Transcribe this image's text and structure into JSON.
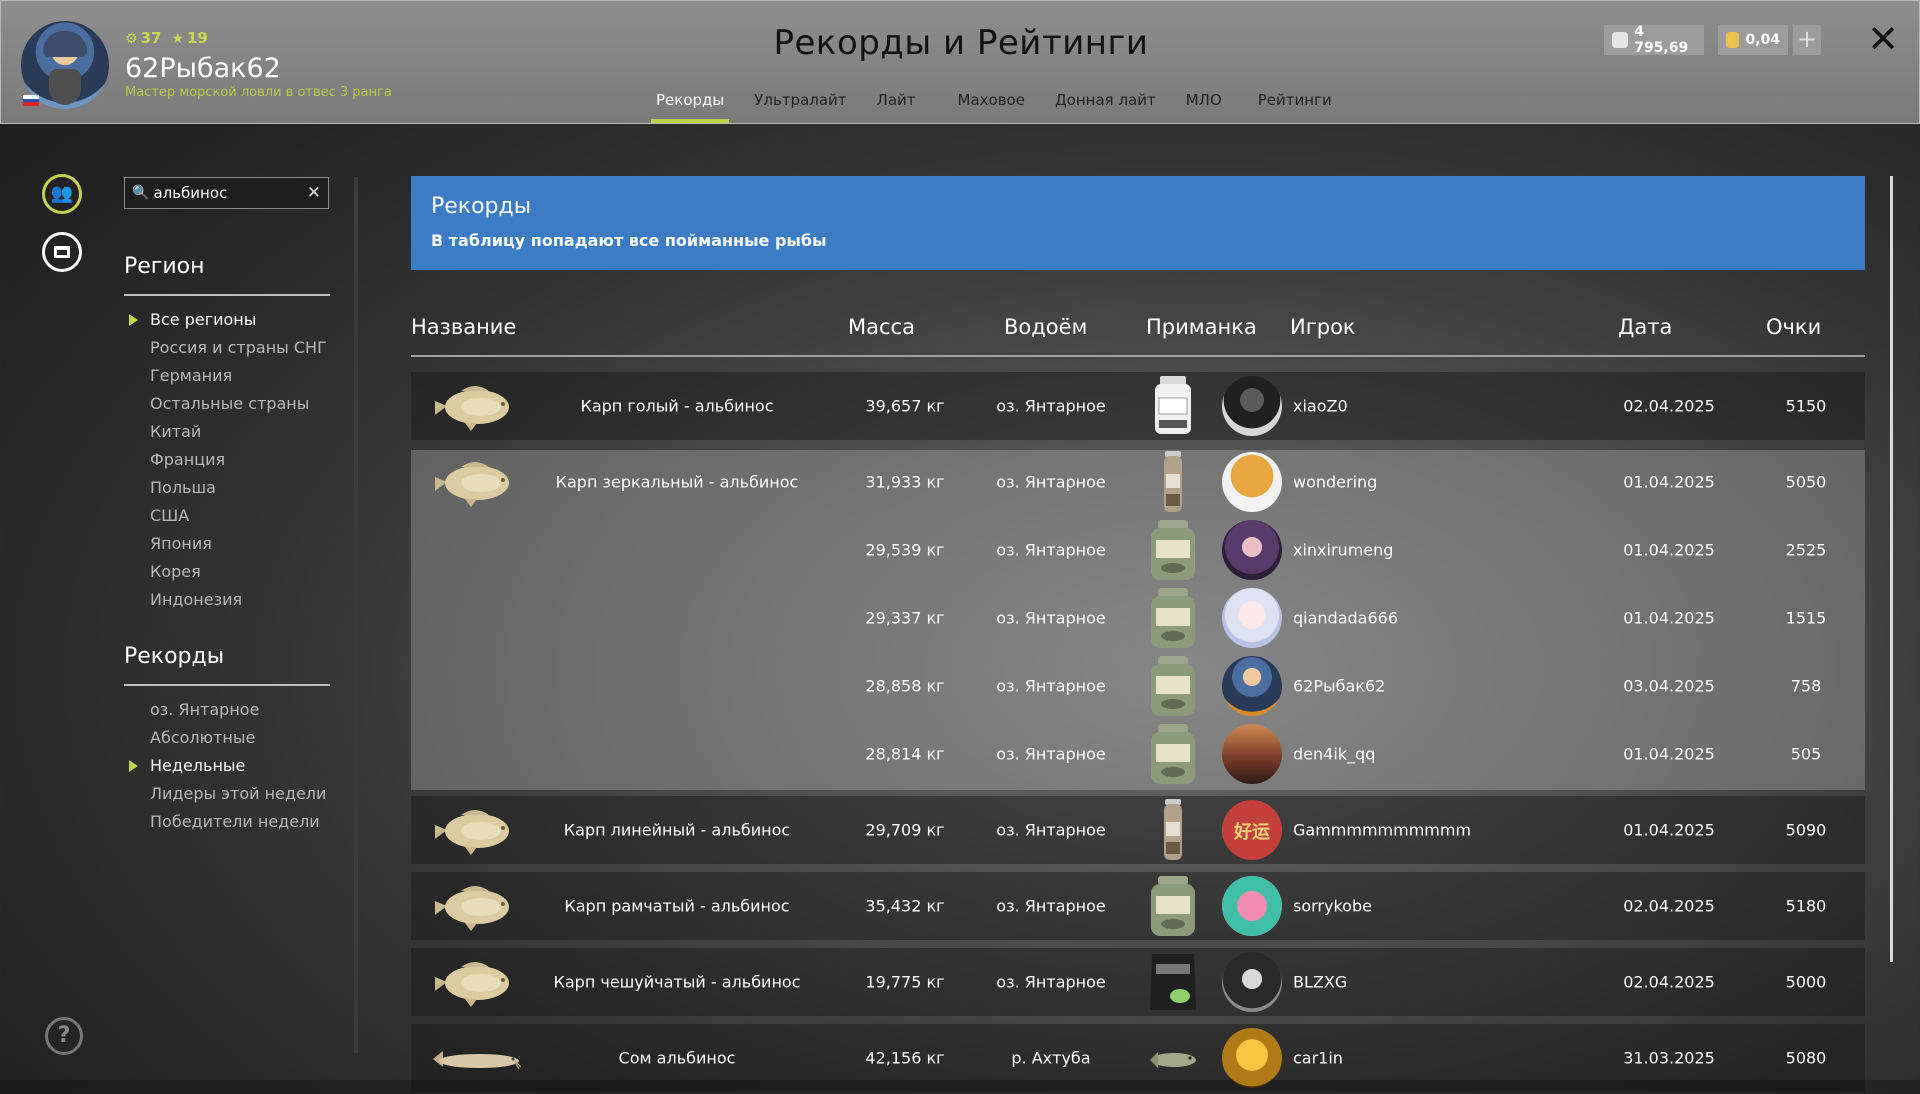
{
  "header": {
    "level": "37",
    "stars": "19",
    "username": "62Рыбак62",
    "rank": "Мастер морской ловли в отвес 3 ранга",
    "title": "Рекорды и Рейтинги",
    "tabs": [
      "Рекорды",
      "Ультралайт",
      "Лайт",
      "Маховое",
      "Донная лайт",
      "МЛО",
      "Рейтинги"
    ],
    "active_tab": "Рекорды",
    "silver": "4 795,69",
    "gold": "0,04"
  },
  "search": {
    "value": "альбинос"
  },
  "sidebar": {
    "region_title": "Регион",
    "regions": [
      {
        "label": "Все регионы",
        "active": true
      },
      {
        "label": "Россия и страны СНГ",
        "active": false
      },
      {
        "label": "Германия",
        "active": false
      },
      {
        "label": "Остальные страны",
        "active": false
      },
      {
        "label": "Китай",
        "active": false
      },
      {
        "label": "Франция",
        "active": false
      },
      {
        "label": "Польша",
        "active": false
      },
      {
        "label": "США",
        "active": false
      },
      {
        "label": "Япония",
        "active": false
      },
      {
        "label": "Корея",
        "active": false
      },
      {
        "label": "Индонезия",
        "active": false
      }
    ],
    "records_title": "Рекорды",
    "records": [
      {
        "label": "оз. Янтарное",
        "active": false
      },
      {
        "label": "Абсолютные",
        "active": false
      },
      {
        "label": "Недельные",
        "active": true
      },
      {
        "label": "Лидеры этой недели",
        "active": false
      },
      {
        "label": "Победители недели",
        "active": false
      }
    ]
  },
  "banner": {
    "title": "Рекорды",
    "subtitle": "В таблицу попадают все пойманные рыбы"
  },
  "table": {
    "columns": {
      "name": "Название",
      "mass": "Масса",
      "water": "Водоём",
      "bait": "Приманка",
      "player": "Игрок",
      "date": "Дата",
      "points": "Очки"
    },
    "rows": [
      {
        "name": "Карп голый - альбинос",
        "mass": "39,657 кг",
        "water": "оз. Янтарное",
        "player": "xiaoZ0",
        "date": "02.04.2025",
        "points": "5150",
        "fish": "carp",
        "bait": "jar-white",
        "avatar": "dark"
      },
      {
        "name": "Карп зеркальный - альбинос",
        "mass": "31,933 кг",
        "water": "оз. Янтарное",
        "player": "wondering",
        "date": "01.04.2025",
        "points": "5050",
        "fish": "carp",
        "bait": "tube",
        "avatar": "dog"
      },
      {
        "name": "",
        "mass": "29,539 кг",
        "water": "оз. Янтарное",
        "player": "xinxirumeng",
        "date": "01.04.2025",
        "points": "2525",
        "fish": "",
        "bait": "jar-green",
        "avatar": "girl"
      },
      {
        "name": "",
        "mass": "29,337 кг",
        "water": "оз. Янтарное",
        "player": "qiandada666",
        "date": "01.04.2025",
        "points": "1515",
        "fish": "",
        "bait": "jar-green",
        "avatar": "anime"
      },
      {
        "name": "",
        "mass": "28,858 кг",
        "water": "оз. Янтарное",
        "player": "62Рыбак62",
        "date": "03.04.2025",
        "points": "758",
        "fish": "",
        "bait": "jar-green",
        "avatar": "fisher"
      },
      {
        "name": "",
        "mass": "28,814 кг",
        "water": "оз. Янтарное",
        "player": "den4ik_qq",
        "date": "01.04.2025",
        "points": "505",
        "fish": "",
        "bait": "jar-green",
        "avatar": "sunset"
      },
      {
        "name": "Карп линейный - альбинос",
        "mass": "29,709 кг",
        "water": "оз. Янтарное",
        "player": "Gammmmmmmmmm",
        "date": "01.04.2025",
        "points": "5090",
        "fish": "carp",
        "bait": "tube",
        "avatar": "red-char",
        "avatar_text": "好运"
      },
      {
        "name": "Карп рамчатый - альбинос",
        "mass": "35,432 кг",
        "water": "оз. Янтарное",
        "player": "sorrykobe",
        "date": "02.04.2025",
        "points": "5180",
        "fish": "carp",
        "bait": "jar-green",
        "avatar": "pink"
      },
      {
        "name": "Карп чешуйчатый - альбинос",
        "mass": "19,775 кг",
        "water": "оз. Янтарное",
        "player": "BLZXG",
        "date": "02.04.2025",
        "points": "5000",
        "fish": "carp",
        "bait": "bag",
        "avatar": "mask"
      },
      {
        "name": "Сом альбинос",
        "mass": "42,156 кг",
        "water": "р. Ахтуба",
        "player": "car1in",
        "date": "31.03.2025",
        "points": "5080",
        "fish": "catfish",
        "bait": "fish",
        "avatar": "gold"
      }
    ]
  },
  "colors": {
    "accent_green": "#c3d34f",
    "banner_blue": "#3b7cc4",
    "header_gray": "#8a8a8a"
  },
  "icons": {
    "close": "close-icon",
    "search": "search-icon",
    "friends": "friends-icon",
    "archive": "archive-icon",
    "help": "help-icon"
  }
}
